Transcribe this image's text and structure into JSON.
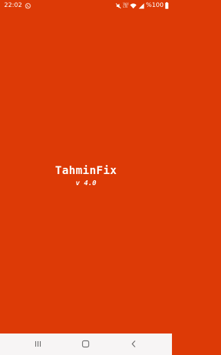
{
  "status_bar": {
    "time": "22:02",
    "notification_icon": "whatsapp-icon",
    "network_label_top": "Vo))",
    "network_label_bottom": "LTE",
    "battery": "%100"
  },
  "splash": {
    "app_name": "TahminFix",
    "version": "v 4.0"
  },
  "colors": {
    "background": "#dd3a06",
    "text": "#ffffff",
    "nav_bar": "#f7f5f5",
    "nav_icon": "#6e6e6e"
  },
  "navigation": {
    "recents_icon": "recents-icon",
    "home_icon": "home-icon",
    "back_icon": "back-icon"
  }
}
